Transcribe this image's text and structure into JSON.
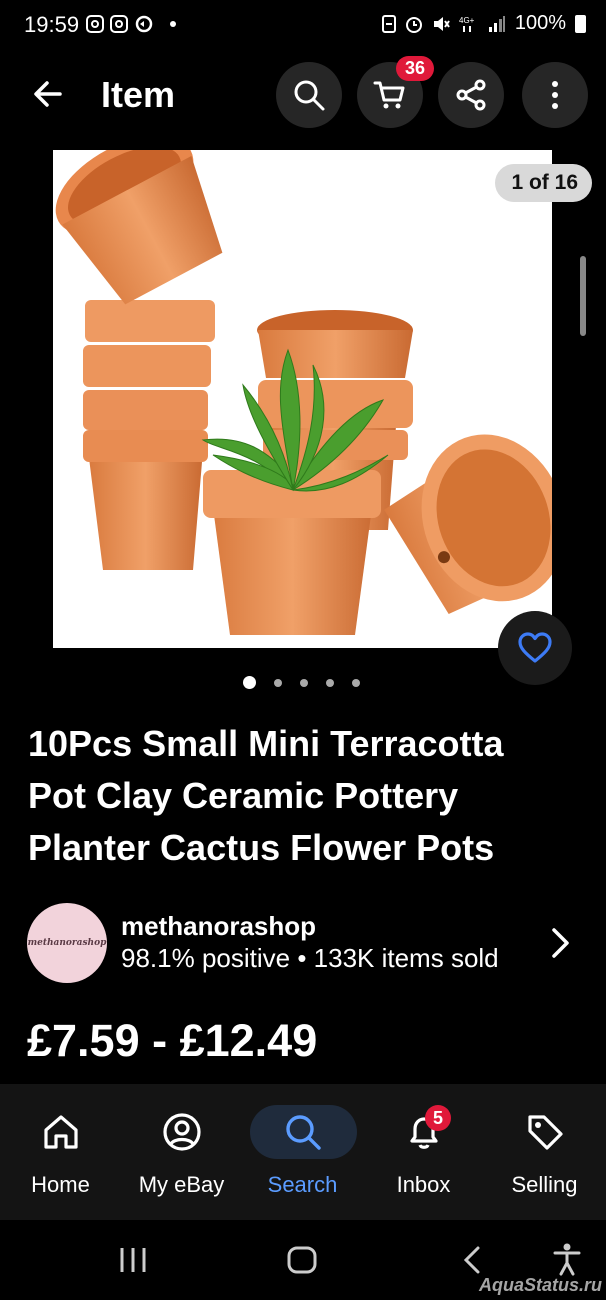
{
  "status_bar": {
    "time": "19:59",
    "battery": "100%"
  },
  "header": {
    "title": "Item",
    "cart_count": "36"
  },
  "gallery": {
    "counter": "1 of 16",
    "dot_count": 5,
    "active_dot": 0
  },
  "product": {
    "title": "10Pcs Small Mini Terracotta Pot Clay Ceramic Pottery Planter Cactus Flower Pots",
    "price": "£7.59 - £12.49"
  },
  "seller": {
    "logo_text": "methanorashop",
    "name": "methanorashop",
    "stats": "98.1% positive • 133K items sold"
  },
  "bottom_nav": {
    "items": [
      {
        "label": "Home",
        "icon": "home-icon"
      },
      {
        "label": "My eBay",
        "icon": "user-icon"
      },
      {
        "label": "Search",
        "icon": "search-icon",
        "active": true
      },
      {
        "label": "Inbox",
        "icon": "bell-icon",
        "badge": "5"
      },
      {
        "label": "Selling",
        "icon": "tag-icon"
      }
    ]
  },
  "watermark": "AquaStatus.ru",
  "colors": {
    "accent": "#5b9cff",
    "badge": "#e0193a",
    "heart": "#3d7bf5"
  }
}
